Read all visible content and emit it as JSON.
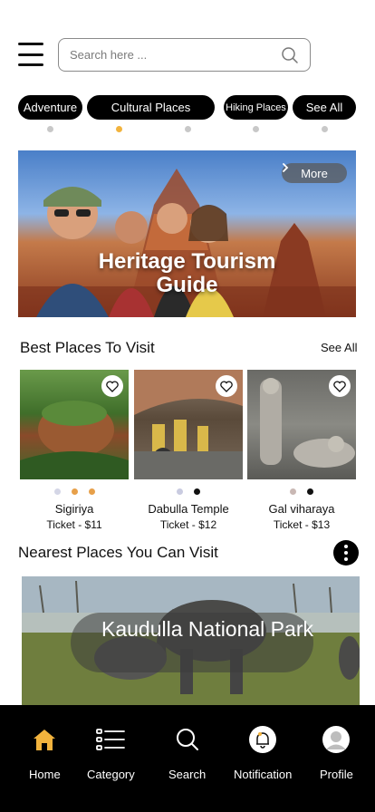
{
  "header": {
    "search_placeholder": "Search here ..."
  },
  "categories": [
    {
      "label": "Adventure"
    },
    {
      "label": "Cultural Places"
    },
    {
      "label": "Hiking Places"
    },
    {
      "label": "See All"
    }
  ],
  "banner": {
    "more_label": "More",
    "title": "Heritage Tourism Guide"
  },
  "best_places": {
    "title": "Best Places To Visit",
    "see_all": "See All",
    "items": [
      {
        "name": "Sigiriya",
        "price": "Ticket - $11"
      },
      {
        "name": "Dabulla Temple",
        "price": "Ticket -  $12"
      },
      {
        "name": "Gal viharaya",
        "price": "Ticket -  $13"
      }
    ]
  },
  "nearest": {
    "title": "Nearest Places You Can Visit",
    "place_name": "Kaudulla National Park"
  },
  "nav": [
    {
      "label": "Home",
      "icon": "home-icon"
    },
    {
      "label": "Category",
      "icon": "category-icon"
    },
    {
      "label": "Search",
      "icon": "search-icon"
    },
    {
      "label": "Notification",
      "icon": "bell-icon"
    },
    {
      "label": "Profile",
      "icon": "user-icon"
    }
  ],
  "colors": {
    "accent": "#f2b33d",
    "nav_bg": "#000000"
  }
}
